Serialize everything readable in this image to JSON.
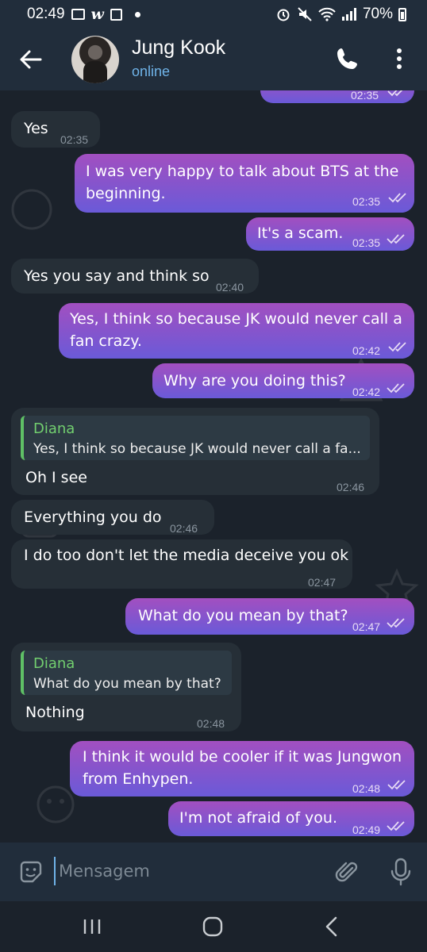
{
  "status_bar": {
    "time": "02:49",
    "battery": "70%"
  },
  "header": {
    "contact_name": "Jung Kook",
    "contact_status": "online"
  },
  "chat": {
    "messages": [
      {
        "dir": "out",
        "text": "",
        "time": "02:35"
      },
      {
        "dir": "in",
        "text": "Yes",
        "time": "02:35"
      },
      {
        "dir": "out",
        "text": "I was very happy to talk about BTS at the beginning.",
        "time": "02:35"
      },
      {
        "dir": "out",
        "text": "It's a scam.",
        "time": "02:35"
      },
      {
        "dir": "in",
        "text": "Yes you say and think so",
        "time": "02:40"
      },
      {
        "dir": "out",
        "text": "Yes, I think so because JK would never call a fan crazy.",
        "time": "02:42"
      },
      {
        "dir": "out",
        "text": "Why are you doing this?",
        "time": "02:42"
      },
      {
        "dir": "in",
        "reply_name": "Diana",
        "reply_text": "Yes, I think so because JK would never call a fa...",
        "text": "Oh I see",
        "time": "02:46"
      },
      {
        "dir": "in",
        "text": "Everything you do",
        "time": "02:46"
      },
      {
        "dir": "in",
        "text": "I do too don't let the media deceive you ok",
        "time": "02:47"
      },
      {
        "dir": "out",
        "text": "What do you mean by that?",
        "time": "02:47"
      },
      {
        "dir": "in",
        "reply_name": "Diana",
        "reply_text": "What do you mean by that?",
        "text": "Nothing",
        "time": "02:48"
      },
      {
        "dir": "out",
        "text": "I think it would be cooler if it was Jungwon from Enhypen.",
        "time": "02:48"
      },
      {
        "dir": "out",
        "text": "I'm not afraid of you.",
        "time": "02:49"
      }
    ]
  },
  "input": {
    "placeholder": "Mensagem"
  },
  "colors": {
    "outgoing_bubble_top": "#a24fc0",
    "outgoing_bubble_bottom": "#6a5ad8",
    "incoming_bubble": "#262f37",
    "header": "#212d3b",
    "online": "#6fb3e8",
    "reply_accent": "#5fc066"
  },
  "icons": {
    "back": "arrow-left-icon",
    "call": "phone-icon",
    "menu": "vertical-dots-icon",
    "emoji": "sticker-smile-icon",
    "attach": "paperclip-icon",
    "mic": "microphone-icon",
    "ticks": "double-check-icon"
  }
}
